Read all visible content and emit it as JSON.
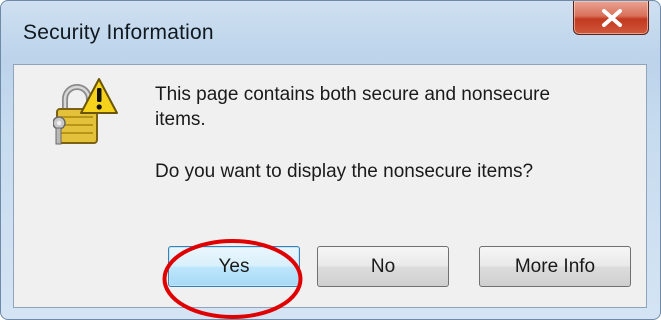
{
  "window": {
    "title": "Security Information",
    "close_icon": "close-icon",
    "close_color": "#c7432a"
  },
  "content": {
    "icon": "security-warning-lock-icon",
    "message": "This page contains both secure and nonsecure items.",
    "question": "Do you want to display the nonsecure items?"
  },
  "buttons": {
    "yes": "Yes",
    "no": "No",
    "more_info": "More Info"
  },
  "annotation": {
    "shape": "circle",
    "target": "yes-button",
    "color": "#e00000"
  }
}
